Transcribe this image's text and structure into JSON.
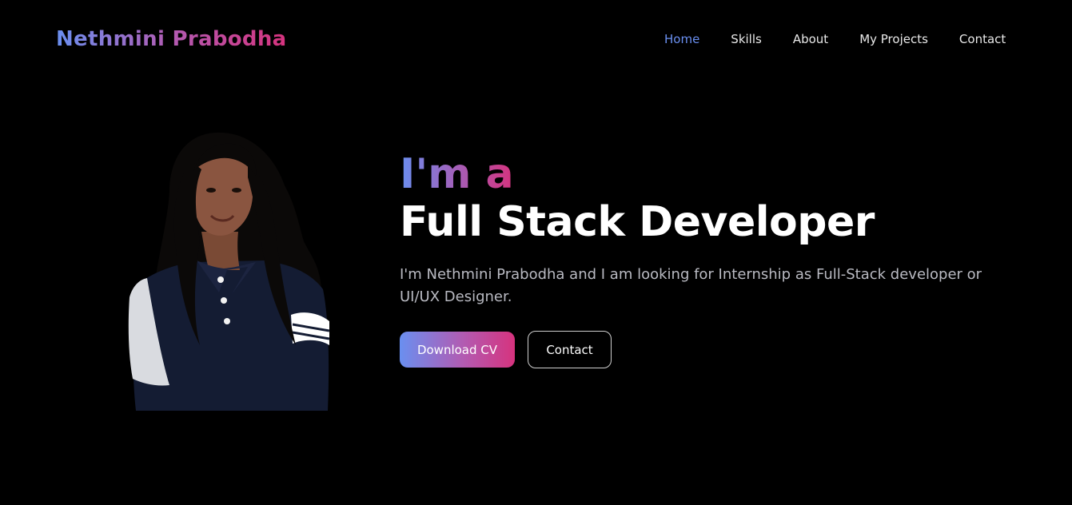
{
  "header": {
    "logo": "Nethmini Prabodha",
    "nav": [
      {
        "label": "Home",
        "active": true
      },
      {
        "label": "Skills",
        "active": false
      },
      {
        "label": "About",
        "active": false
      },
      {
        "label": "My Projects",
        "active": false
      },
      {
        "label": "Contact",
        "active": false
      }
    ]
  },
  "hero": {
    "intro": "I'm a",
    "title": "Full Stack Developer",
    "description": "I'm Nethmini Prabodha and I am looking for Internship as Full-Stack developer or UI/UX Designer.",
    "primary_button": "Download CV",
    "secondary_button": "Contact"
  },
  "colors": {
    "background": "#000000",
    "accent_blue": "#6a8ff0",
    "accent_purple": "#b25bb2",
    "accent_pink": "#d6337e",
    "text_muted": "#b9bac2"
  }
}
